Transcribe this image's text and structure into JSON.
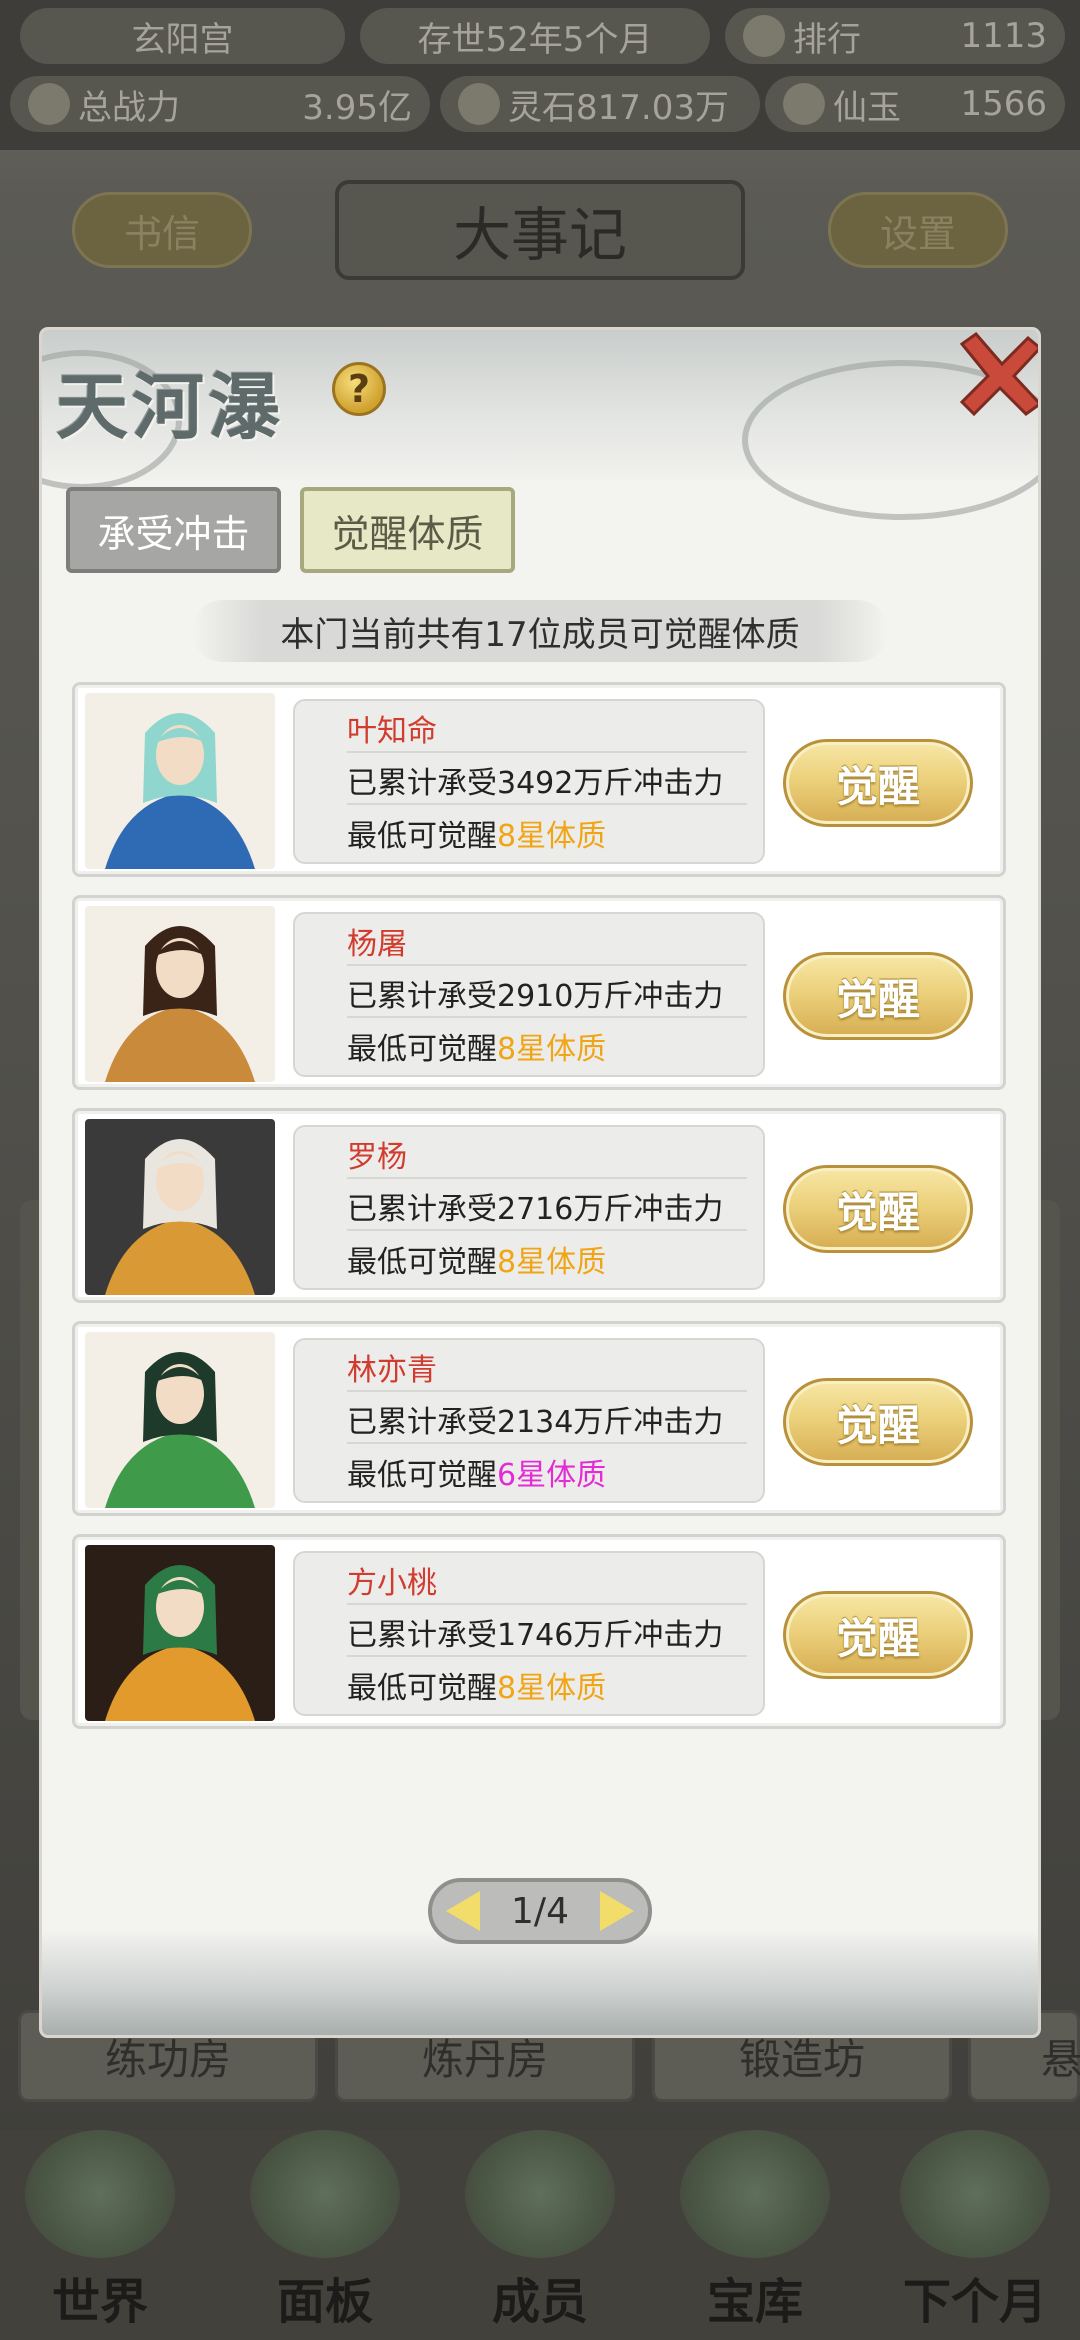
{
  "topbar": {
    "sect_name": "玄阳宫",
    "age": "存世52年5个月",
    "rank_label": "排行",
    "rank_value": "1113",
    "power_label": "总战力",
    "power_value": "3.95亿",
    "spirit_stone": "灵石817.03万",
    "jade_label": "仙玉",
    "jade_value": "1566"
  },
  "subbar": {
    "letters": "书信",
    "event_title": "大事记",
    "settings": "设置"
  },
  "background_rooms": [
    "练功房",
    "炼丹房",
    "锻造坊",
    "悬"
  ],
  "bottom_nav": [
    "世界",
    "面板",
    "成员",
    "宝库",
    "下个月"
  ],
  "dialog": {
    "title": "天河瀑",
    "help": "?",
    "tabs": [
      "承受冲击",
      "觉醒体质"
    ],
    "active_tab": "觉醒体质",
    "banner": "本门当前共有17位成员可觉醒体质",
    "awaken_label": "觉醒",
    "members": [
      {
        "name": "叶知命",
        "impact": "已累计承受3492万斤冲击力",
        "min_prefix": "最低可觉醒",
        "tier": "8星体质",
        "tier_color": "#f0a516",
        "palette": [
          "#2f6bb5",
          "#8fd6cf",
          "#f4efe6"
        ]
      },
      {
        "name": "杨屠",
        "impact": "已累计承受2910万斤冲击力",
        "min_prefix": "最低可觉醒",
        "tier": "8星体质",
        "tier_color": "#f0a516",
        "palette": [
          "#c98a3c",
          "#3a2418",
          "#f4efe6"
        ]
      },
      {
        "name": "罗杨",
        "impact": "已累计承受2716万斤冲击力",
        "min_prefix": "最低可觉醒",
        "tier": "8星体质",
        "tier_color": "#f0a516",
        "palette": [
          "#d99a36",
          "#e9e6df",
          "#3a3a3a"
        ]
      },
      {
        "name": "林亦青",
        "impact": "已累计承受2134万斤冲击力",
        "min_prefix": "最低可觉醒",
        "tier": "6星体质",
        "tier_color": "#e42bd6",
        "palette": [
          "#3f9a4a",
          "#1e3a2a",
          "#f4efe6"
        ]
      },
      {
        "name": "方小桃",
        "impact": "已累计承受1746万斤冲击力",
        "min_prefix": "最低可觉醒",
        "tier": "8星体质",
        "tier_color": "#f0a516",
        "palette": [
          "#e39a2c",
          "#2c7a45",
          "#2a1e16"
        ]
      }
    ],
    "pager": {
      "current": 1,
      "total": 4,
      "text": "1/4"
    }
  },
  "colors": {
    "member_name": "#d23c2f",
    "tier_gold": "#f0a516",
    "tier_pink": "#e42bd6",
    "button_gold": "#ecd17c"
  }
}
